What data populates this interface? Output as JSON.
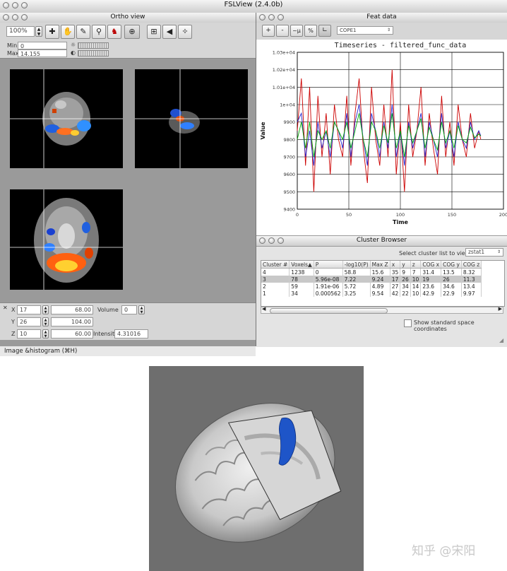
{
  "app_title": "FSLView (2.4.0b)",
  "ortho": {
    "title": "Ortho view",
    "zoom": "100%",
    "min_label": "Min",
    "min_value": "0",
    "max_label": "Max",
    "max_value": "14.155",
    "coords": {
      "x_label": "X",
      "x_value": "17",
      "x_mm": "68.00",
      "y_label": "Y",
      "y_value": "26",
      "y_mm": "104.00",
      "z_label": "Z",
      "z_value": "10",
      "z_mm": "60.00",
      "volume_label": "Volume",
      "volume_value": "0",
      "intensity_label": "Intensity",
      "intensity_value": "4.31016"
    },
    "status": "Image &histogram (⌘H)"
  },
  "feat": {
    "title": "Feat data",
    "tool_plus": "+",
    "tool_minus": "-",
    "tool_mu": "~μ",
    "tool_pct": "%",
    "cope_select": "COPE1",
    "chart_title": "Timeseries - filtered_func_data"
  },
  "chart_data": {
    "type": "line",
    "title": "Timeseries - filtered_func_data",
    "xlabel": "Time",
    "ylabel": "Value",
    "xlim": [
      0,
      200
    ],
    "ylim": [
      9400,
      10300
    ],
    "xticks": [
      0,
      50,
      100,
      150,
      200
    ],
    "yticks": [
      9400,
      9500,
      9600,
      9700,
      9800,
      9900,
      10000,
      10100,
      10200,
      10300
    ],
    "ytick_labels": [
      "9400",
      "9500",
      "9600",
      "9700",
      "9800",
      "9900",
      "1e+04",
      "1.01e+04",
      "1.02e+04",
      "1.03e+04"
    ],
    "grid": true,
    "series": [
      {
        "color": "#cc0000",
        "x": [
          0,
          4,
          8,
          12,
          16,
          20,
          24,
          28,
          32,
          36,
          40,
          44,
          48,
          52,
          56,
          60,
          64,
          68,
          72,
          76,
          80,
          84,
          88,
          92,
          96,
          100,
          104,
          108,
          112,
          116,
          120,
          124,
          128,
          132,
          136,
          140,
          144,
          148,
          152,
          156,
          160,
          164,
          168,
          172,
          176,
          178
        ],
        "values": [
          9850,
          10150,
          9650,
          10100,
          9500,
          10050,
          9700,
          9950,
          9600,
          10000,
          9800,
          9700,
          10050,
          9650,
          9950,
          10150,
          9750,
          9550,
          10100,
          9800,
          9650,
          10000,
          9700,
          10200,
          9600,
          9900,
          9500,
          10000,
          9700,
          9850,
          10100,
          9650,
          9950,
          9750,
          9600,
          10050,
          9700,
          9900,
          9650,
          10000,
          9800,
          9700,
          9950,
          9750,
          9850,
          9800
        ]
      },
      {
        "color": "#2222cc",
        "x": [
          0,
          4,
          8,
          12,
          16,
          20,
          24,
          28,
          32,
          36,
          40,
          44,
          48,
          52,
          56,
          60,
          64,
          68,
          72,
          76,
          80,
          84,
          88,
          92,
          96,
          100,
          104,
          108,
          112,
          116,
          120,
          124,
          128,
          132,
          136,
          140,
          144,
          148,
          152,
          156,
          160,
          164,
          168,
          172,
          176,
          178
        ],
        "values": [
          9900,
          9950,
          9700,
          9850,
          9650,
          9900,
          9750,
          9850,
          9700,
          9900,
          9850,
          9750,
          9950,
          9700,
          9900,
          10000,
          9800,
          9650,
          9950,
          9850,
          9700,
          9900,
          9750,
          10000,
          9700,
          9850,
          9650,
          9900,
          9750,
          9850,
          9950,
          9700,
          9900,
          9800,
          9700,
          9950,
          9750,
          9850,
          9700,
          9900,
          9800,
          9750,
          9900,
          9800,
          9850,
          9820
        ]
      },
      {
        "color": "#00aa00",
        "x": [
          0,
          4,
          8,
          12,
          16,
          20,
          24,
          28,
          32,
          36,
          40,
          44,
          48,
          52,
          56,
          60,
          64,
          68,
          72,
          76,
          80,
          84,
          88,
          92,
          96,
          100,
          104,
          108,
          112,
          116,
          120,
          124,
          128,
          132,
          136,
          140,
          144,
          148,
          152,
          156,
          160,
          164,
          168,
          172,
          176,
          178
        ],
        "values": [
          9800,
          9900,
          9750,
          9900,
          9700,
          9850,
          9800,
          9850,
          9750,
          9900,
          9850,
          9800,
          9900,
          9750,
          9850,
          9950,
          9800,
          9700,
          9900,
          9850,
          9750,
          9880,
          9780,
          9950,
          9750,
          9850,
          9700,
          9880,
          9780,
          9850,
          9920,
          9750,
          9870,
          9800,
          9740,
          9900,
          9780,
          9850,
          9750,
          9880,
          9800,
          9780,
          9870,
          9810,
          9830,
          9820
        ]
      }
    ]
  },
  "cluster": {
    "title": "Cluster Browser",
    "select_label": "Select cluster list to view",
    "select_value": "zstat1",
    "headers": [
      "Cluster #",
      "Voxels▲",
      "P",
      "-log10(P)",
      "Max Z",
      "x",
      "y",
      "z",
      "COG x",
      "COG y",
      "COG z"
    ],
    "rows": [
      [
        "4",
        "1238",
        "0",
        "58.8",
        "15.6",
        "35",
        "9",
        "7",
        "31.4",
        "13.5",
        "8.32"
      ],
      [
        "3",
        "78",
        "5.96e-08",
        "7.22",
        "9.24",
        "17",
        "26",
        "10",
        "19",
        "26",
        "11.3"
      ],
      [
        "2",
        "59",
        "1.91e-06",
        "5.72",
        "4.89",
        "27",
        "34",
        "14",
        "23.6",
        "34.6",
        "13.4"
      ],
      [
        "1",
        "34",
        "0.000562",
        "3.25",
        "9.54",
        "42",
        "22",
        "10",
        "42.9",
        "22.9",
        "9.97"
      ]
    ],
    "checkbox_label": "Show standard space coordinates"
  },
  "watermark": "知乎 @宋阳"
}
